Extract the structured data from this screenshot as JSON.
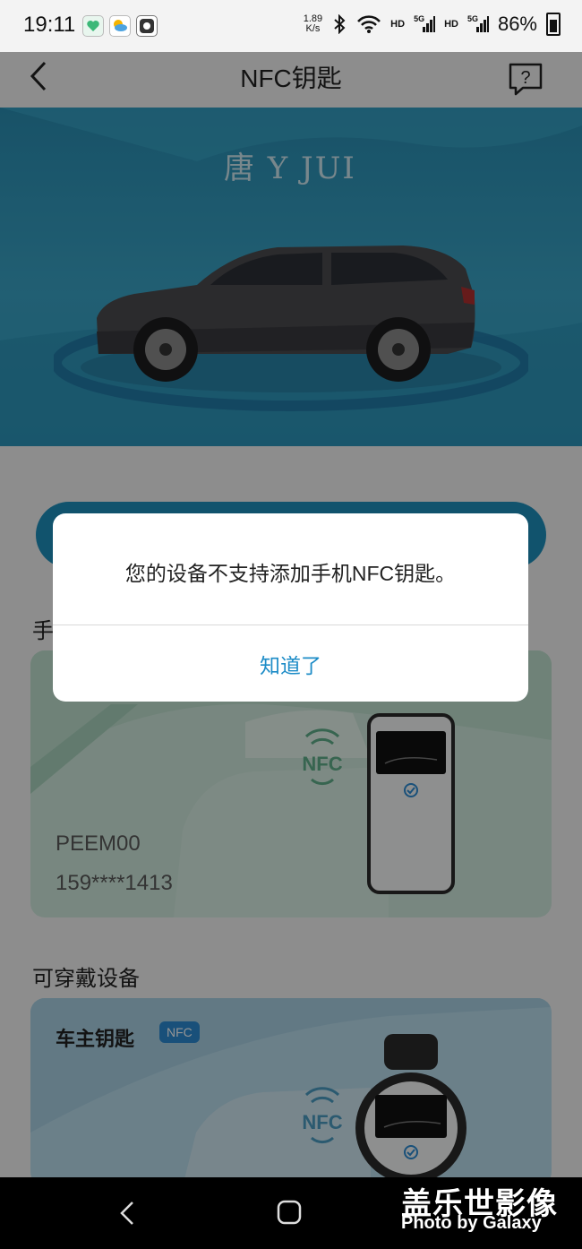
{
  "status_bar": {
    "time": "19:11",
    "net_speed_value": "1.89",
    "net_speed_unit": "K/s",
    "hd1": "HD",
    "sig1": "5G",
    "hd2": "HD",
    "sig2": "5G",
    "battery": "86%"
  },
  "header": {
    "title": "NFC钥匙",
    "back_icon": "back-arrow-icon",
    "help_icon": "help-icon"
  },
  "hero": {
    "brand_text": "唐 Y JUI"
  },
  "page": {
    "phone_section_label_partial": "手",
    "phone_card": {
      "model": "PEEM00",
      "phone": "159****1413"
    },
    "wearable_section_label": "可穿戴设备",
    "wearable_card": {
      "title": "车主钥匙",
      "badge": "NFC"
    }
  },
  "dialog": {
    "message": "您的设备不支持添加手机NFC钥匙。",
    "confirm_label": "知道了"
  },
  "watermark": {
    "line1": "盖乐世影像",
    "line2": "Photo by Galaxy"
  },
  "colors": {
    "accent": "#1d8cc7",
    "hero_bg": "#2f9cc1",
    "phone_card_bg": "#cfe9dc",
    "wearable_card_bg": "#b9dcec"
  }
}
